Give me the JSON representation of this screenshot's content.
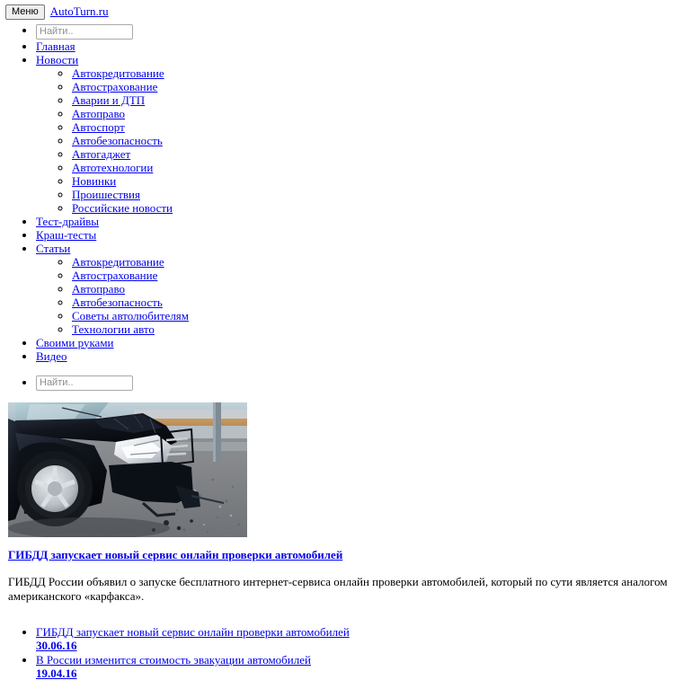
{
  "header": {
    "menu_button_label": "Меню",
    "brand_label": "AutoTurn.ru"
  },
  "search": {
    "placeholder": "Найти..",
    "value": ""
  },
  "nav": {
    "items": [
      {
        "label": "Главная",
        "children": []
      },
      {
        "label": "Новости",
        "children": [
          {
            "label": "Автокредитование"
          },
          {
            "label": "Автострахование"
          },
          {
            "label": "Аварии и ДТП"
          },
          {
            "label": "Автоправо"
          },
          {
            "label": "Автоспорт"
          },
          {
            "label": "Автобезопасность"
          },
          {
            "label": "Автогаджет"
          },
          {
            "label": "Автотехнологии"
          },
          {
            "label": "Новинки"
          },
          {
            "label": "Проишествия"
          },
          {
            "label": "Российские новости"
          }
        ]
      },
      {
        "label": "Тест-драйвы",
        "children": []
      },
      {
        "label": "Краш-тесты",
        "children": []
      },
      {
        "label": "Статьи",
        "children": [
          {
            "label": "Автокредитование"
          },
          {
            "label": "Автострахование"
          },
          {
            "label": "Автоправо"
          },
          {
            "label": "Автобезопасность"
          },
          {
            "label": "Советы автолюбителям"
          },
          {
            "label": "Технологии авто"
          }
        ]
      },
      {
        "label": "Своими руками",
        "children": []
      },
      {
        "label": "Видео",
        "children": []
      }
    ]
  },
  "hero": {
    "alt": "crashed-black-suv-photo"
  },
  "article": {
    "title": "ГИБДД запускает новый сервис онлайн проверки автомобилей",
    "lead": "ГИБДД России объявил о запуске бесплатного интернет-сервиса онлайн проверки автомобилей,  который по сути является аналогом американского «карфакса»."
  },
  "news_list": [
    {
      "title": "ГИБДД запускает новый сервис онлайн проверки автомобилей",
      "date": "30.06.16"
    },
    {
      "title": "В России изменится стоимость эвакуации автомобилей",
      "date": "19.04.16"
    }
  ],
  "colors": {
    "link": "#0000ee",
    "text": "#000000",
    "button_bg": "#efefef"
  }
}
